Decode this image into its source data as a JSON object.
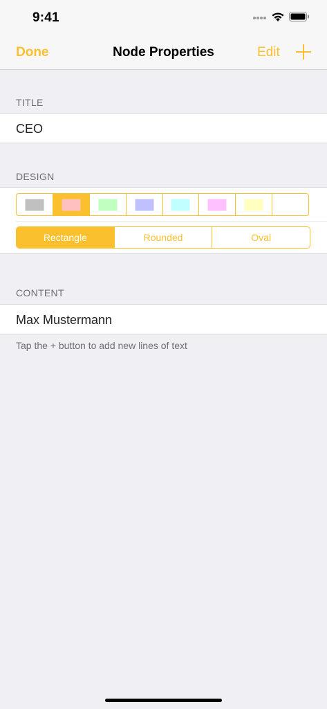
{
  "status_bar": {
    "time": "9:41",
    "icons": [
      "signal-icon",
      "wifi-icon",
      "battery-icon"
    ]
  },
  "nav": {
    "done_label": "Done",
    "title": "Node Properties",
    "edit_label": "Edit",
    "add_icon": "plus-icon"
  },
  "title_section": {
    "header": "TITLE",
    "value": "CEO"
  },
  "design_section": {
    "header": "DESIGN",
    "colors": [
      {
        "name": "gray",
        "hex": "#c0c0c0",
        "selected": false
      },
      {
        "name": "red",
        "hex": "#ffc0c0",
        "selected": true
      },
      {
        "name": "green",
        "hex": "#c0ffc0",
        "selected": false
      },
      {
        "name": "blue",
        "hex": "#c0c0ff",
        "selected": false
      },
      {
        "name": "cyan",
        "hex": "#c0ffff",
        "selected": false
      },
      {
        "name": "magenta",
        "hex": "#ffc0ff",
        "selected": false
      },
      {
        "name": "yellow",
        "hex": "#ffffc0",
        "selected": false
      },
      {
        "name": "white",
        "hex": "#ffffff",
        "selected": false
      }
    ],
    "shapes": [
      {
        "label": "Rectangle",
        "selected": true
      },
      {
        "label": "Rounded",
        "selected": false
      },
      {
        "label": "Oval",
        "selected": false
      }
    ]
  },
  "content_section": {
    "header": "CONTENT",
    "lines": [
      "Max Mustermann"
    ],
    "footer": "Tap the + button to add new lines of text"
  },
  "theme": {
    "accent": "#fbc02d",
    "background": "#efeff4"
  }
}
